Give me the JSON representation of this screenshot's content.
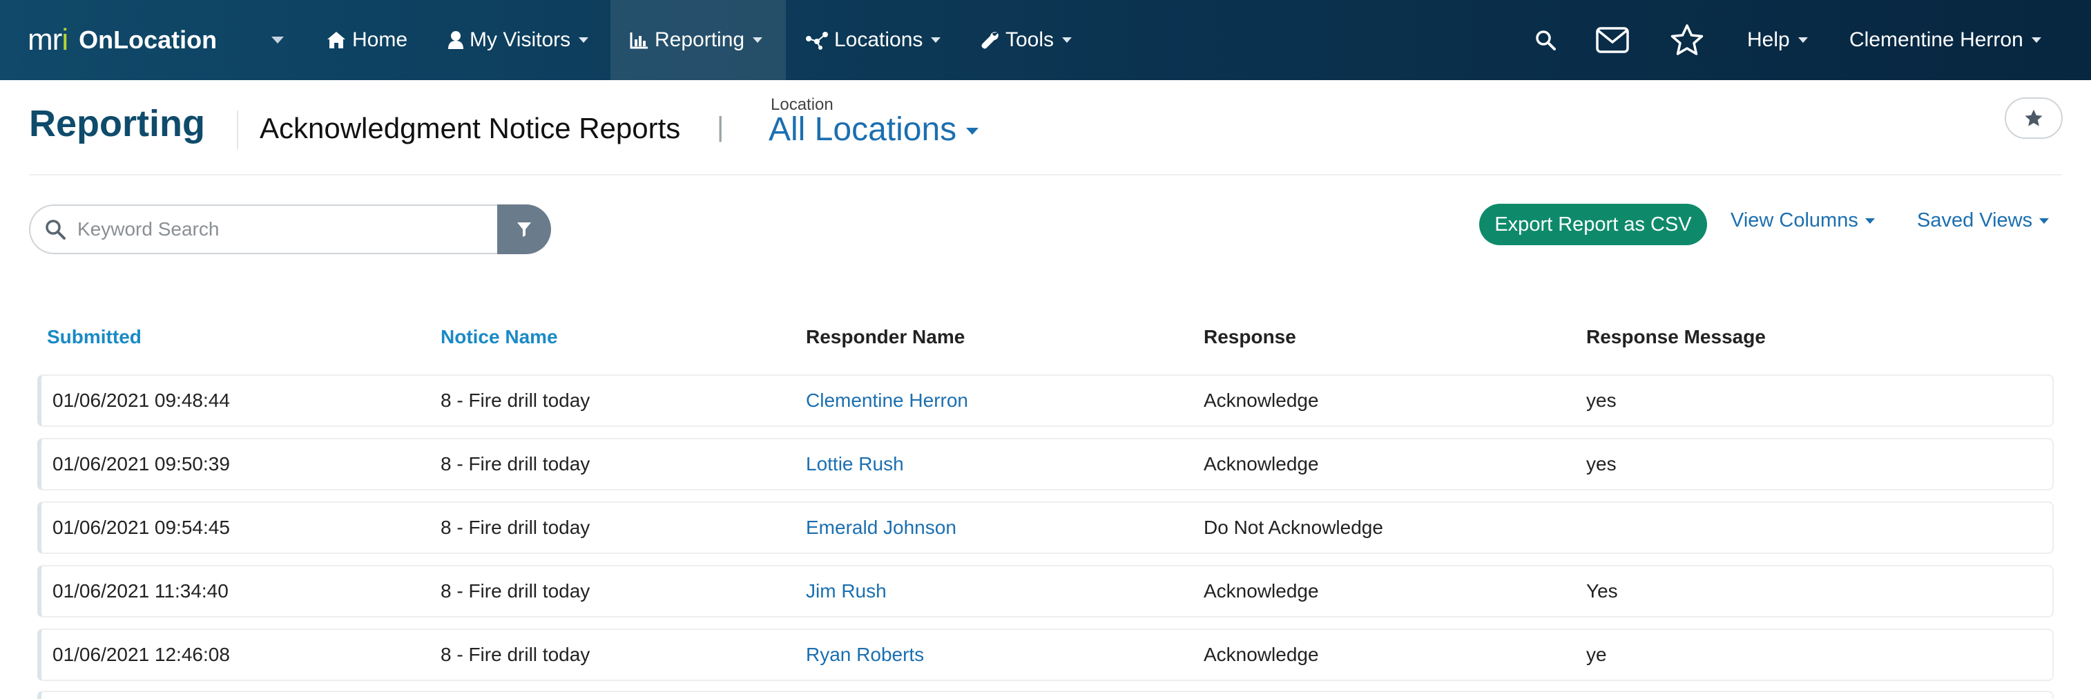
{
  "brand": {
    "logo_prefix": "mr",
    "logo_i": "i",
    "name": "OnLocation"
  },
  "nav": {
    "home": "Home",
    "my_visitors": "My Visitors",
    "reporting": "Reporting",
    "locations": "Locations",
    "tools": "Tools",
    "help": "Help",
    "user": "Clementine Herron"
  },
  "header": {
    "title": "Reporting",
    "subtitle": "Acknowledgment Notice Reports",
    "separator": "|",
    "location_label": "Location",
    "location_value": "All Locations"
  },
  "toolbar": {
    "search_placeholder": "Keyword Search",
    "search_value": "",
    "export_label": "Export Report as CSV",
    "view_columns_label": "View Columns",
    "saved_views_label": "Saved Views"
  },
  "table": {
    "columns": [
      "Submitted",
      "Notice Name",
      "Responder Name",
      "Response",
      "Response Message"
    ],
    "rows": [
      [
        "01/06/2021 09:48:44",
        "8 - Fire drill today",
        "Clementine Herron",
        "Acknowledge",
        "yes"
      ],
      [
        "01/06/2021 09:50:39",
        "8 - Fire drill today",
        "Lottie Rush",
        "Acknowledge",
        "yes"
      ],
      [
        "01/06/2021 09:54:45",
        "8 - Fire drill today",
        "Emerald Johnson",
        "Do Not Acknowledge",
        ""
      ],
      [
        "01/06/2021 11:34:40",
        "8 - Fire drill today",
        "Jim Rush",
        "Acknowledge",
        "Yes"
      ],
      [
        "01/06/2021 12:46:08",
        "8 - Fire drill today",
        "Ryan Roberts",
        "Acknowledge",
        "ye"
      ]
    ]
  },
  "colors": {
    "nav_bg": "#0b3350",
    "brand_title": "#0f4b6b",
    "link": "#1b6fb0",
    "sort_header": "#1a8ac6",
    "export_button": "#0e8a6b",
    "filter_button": "#6a7b8b"
  },
  "icons": [
    "home-icon",
    "user-icon",
    "chart-icon",
    "locations-icon",
    "wrench-icon",
    "search-icon",
    "envelope-icon",
    "star-icon",
    "filter-icon"
  ]
}
